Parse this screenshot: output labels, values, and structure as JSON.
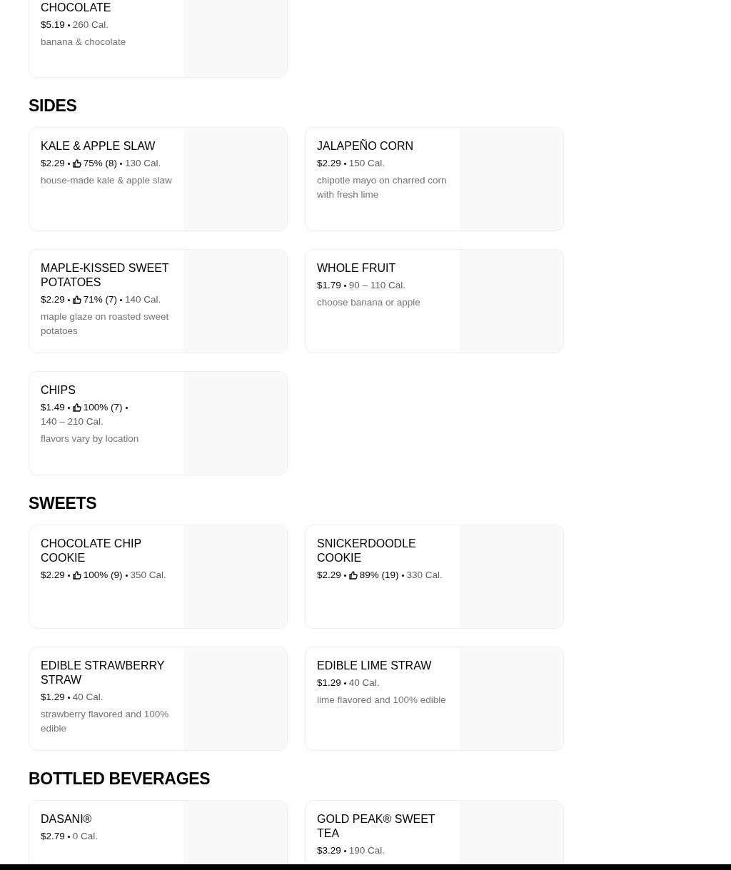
{
  "sections": [
    {
      "items": [
        {
          "name": "CHOCOLATE",
          "price": "$5.19",
          "calories": "260 Cal.",
          "description": "banana & chocolate"
        }
      ]
    },
    {
      "heading": "SIDES",
      "items": [
        {
          "name": "KALE & APPLE SLAW",
          "price": "$2.29",
          "rating": "75% (8)",
          "calories": "130 Cal.",
          "description": "house-made kale & apple slaw"
        },
        {
          "name": "JALAPEÑO CORN",
          "price": "$2.29",
          "calories": "150 Cal.",
          "description": "chipotle mayo on charred corn with fresh lime"
        },
        {
          "name": "MAPLE-KISSED SWEET POTATOES",
          "price": "$2.29",
          "rating": "71% (7)",
          "calories": "140 Cal.",
          "description": "maple glaze on roasted sweet potatoes"
        },
        {
          "name": "WHOLE FRUIT",
          "price": "$1.79",
          "calories": "90 – 110 Cal.",
          "description": "choose banana or apple"
        },
        {
          "name": "CHIPS",
          "price": "$1.49",
          "rating": "100% (7)",
          "calories": "140 – 210 Cal.",
          "description": "flavors vary by location"
        }
      ]
    },
    {
      "heading": "SWEETS",
      "items": [
        {
          "name": "CHOCOLATE CHIP COOKIE",
          "price": "$2.29",
          "rating": "100% (9)",
          "calories": "350 Cal."
        },
        {
          "name": "SNICKERDOODLE COOKIE",
          "price": "$2.29",
          "rating": "89% (19)",
          "calories": "330 Cal."
        },
        {
          "name": "EDIBLE STRAWBERRY STRAW",
          "price": "$1.29",
          "calories": "40 Cal.",
          "description": "strawberry flavored and 100% edible"
        },
        {
          "name": "EDIBLE LIME STRAW",
          "price": "$1.29",
          "calories": "40 Cal.",
          "description": "lime flavored and 100% edible"
        }
      ]
    },
    {
      "heading": "BOTTLED BEVERAGES",
      "items": [
        {
          "name": "DASANI®",
          "price": "$2.79",
          "calories": "0 Cal."
        },
        {
          "name": "GOLD PEAK® SWEET TEA",
          "price": "$3.29",
          "calories": "190 Cal."
        }
      ]
    }
  ]
}
